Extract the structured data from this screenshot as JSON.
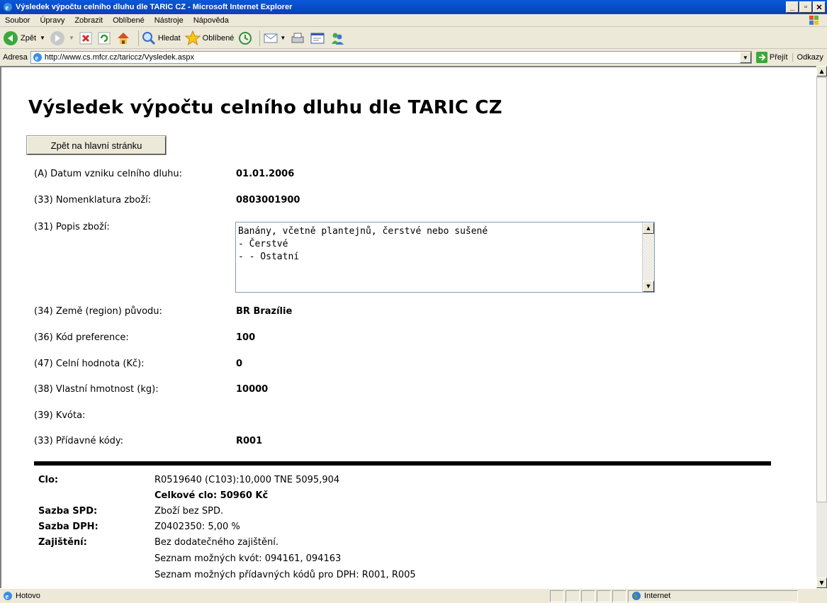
{
  "window": {
    "title": "Výsledek výpočtu celního dluhu dle TARIC CZ - Microsoft Internet Explorer",
    "buttons": [
      "_",
      "▫",
      "✕"
    ]
  },
  "menu": [
    "Soubor",
    "Úpravy",
    "Zobrazit",
    "Oblíbené",
    "Nástroje",
    "Nápověda"
  ],
  "toolbar": {
    "back": "Zpět",
    "search": "Hledat",
    "favorites": "Oblíbené"
  },
  "address": {
    "label": "Adresa",
    "url": "http://www.cs.mfcr.cz/tariccz/Vysledek.aspx",
    "go": "Přejít",
    "links": "Odkazy"
  },
  "page": {
    "title": "Výsledek výpočtu celního dluhu dle TARIC CZ",
    "back_button": "Zpět na hlavní stránku",
    "fields": [
      {
        "label": "(A) Datum vzniku celního dluhu:",
        "value": "01.01.2006"
      },
      {
        "label": "(33) Nomenklatura zboží:",
        "value": "0803001900"
      },
      {
        "label": "(31) Popis zboží:",
        "value": ""
      },
      {
        "label": "(34) Země (region) původu:",
        "value": "BR Brazílie"
      },
      {
        "label": "(36) Kód preference:",
        "value": "100"
      },
      {
        "label": "(47) Celní hodnota (Kč):",
        "value": "0"
      },
      {
        "label": "(38) Vlastní hmotnost (kg):",
        "value": "10000"
      },
      {
        "label": "(39) Kvóta:",
        "value": ""
      },
      {
        "label": "(33) Přídavné kódy:",
        "value": "R001"
      }
    ],
    "description": "Banány, včetně plantejnů, čerstvé nebo sušené\n- Čerstvé\n- - Ostatní",
    "results": {
      "clo_label": "Clo:",
      "clo_line": "R0519640 (C103):10,000 TNE 5095,904",
      "clo_total": "Celkové clo: 50960 Kč",
      "spd_label": "Sazba SPD:",
      "spd_value": "Zboží bez SPD.",
      "dph_label": "Sazba DPH:",
      "dph_value": "Z0402350: 5,00 %",
      "zaj_label": "Zajištění:",
      "zaj_value": "Bez dodatečného zajištění.",
      "kvoty": "Seznam možných kvót: 094161, 094163",
      "pridavne": "Seznam možných přídavných kódů pro DPH: R001, R005"
    }
  },
  "status": {
    "text": "Hotovo",
    "zone": "Internet"
  }
}
